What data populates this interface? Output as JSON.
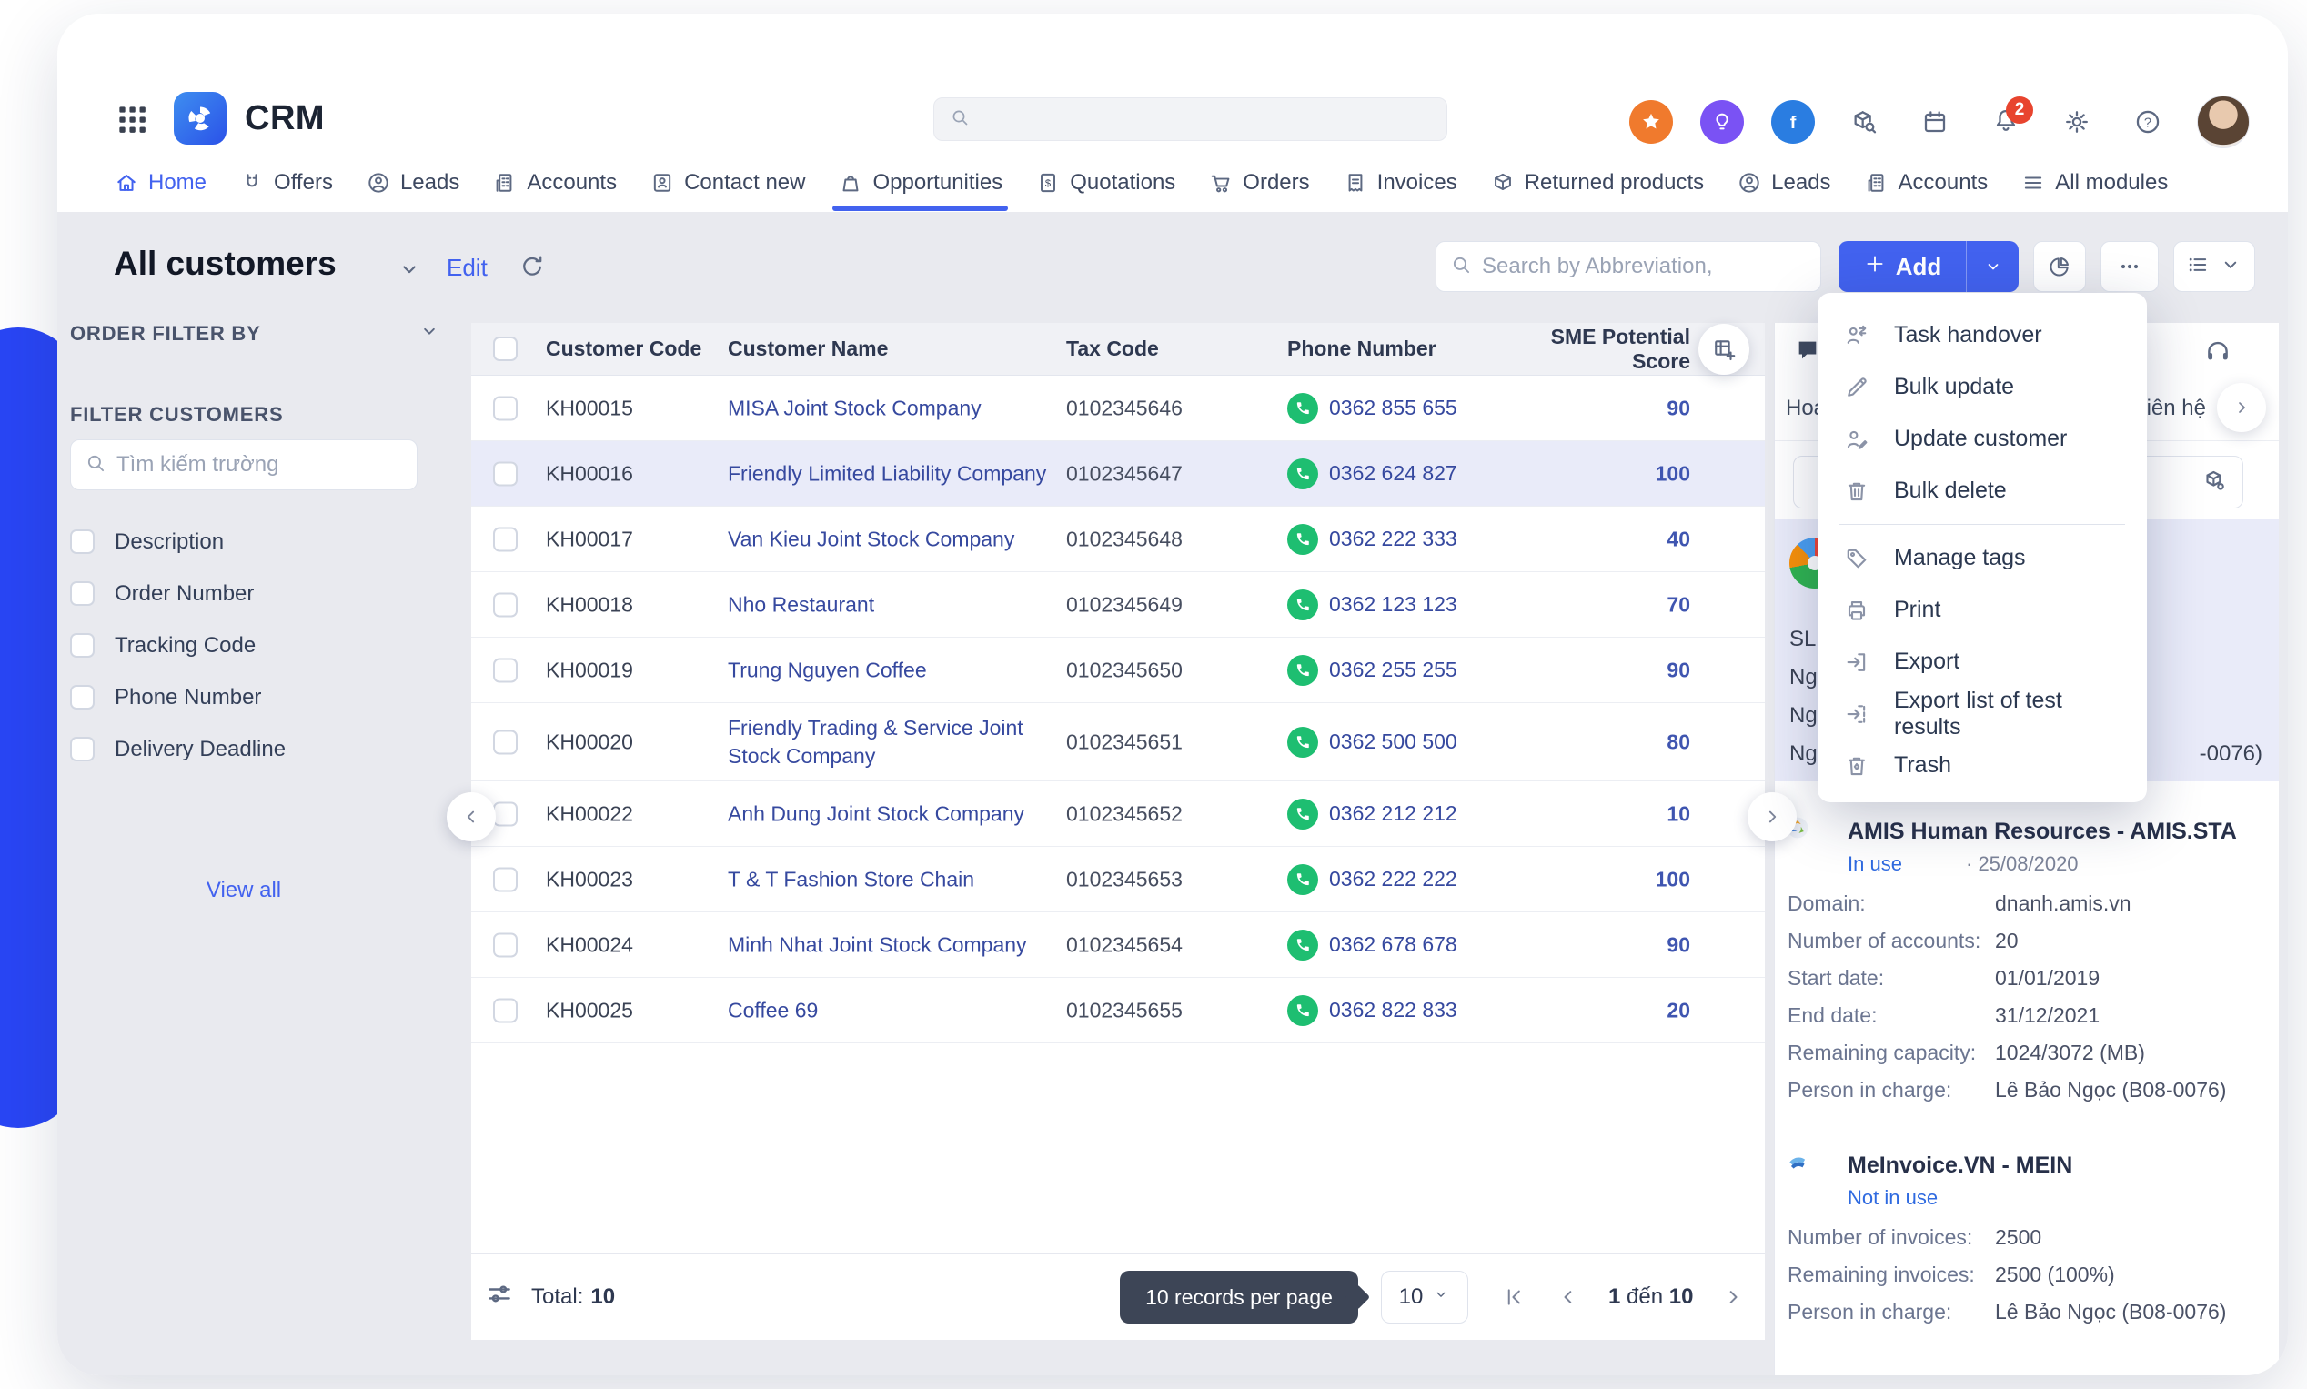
{
  "colors": {
    "accent": "#4262ef",
    "link": "#36499f",
    "green": "#1ebe71",
    "highlight": "#e9ebf9",
    "tooltip_bg": "#3d4556",
    "blob": "#2946f5"
  },
  "topbar": {
    "app_name": "CRM",
    "global_search_placeholder": "",
    "notification_count": "2"
  },
  "nav": {
    "active_index": 5,
    "items": [
      {
        "label": "Home",
        "icon": "home"
      },
      {
        "label": "Offers",
        "icon": "magnet"
      },
      {
        "label": "Leads",
        "icon": "person-circle"
      },
      {
        "label": "Accounts",
        "icon": "building"
      },
      {
        "label": "Contact new",
        "icon": "contact-card"
      },
      {
        "label": "Opportunities",
        "icon": "wallet"
      },
      {
        "label": "Quotations",
        "icon": "doc-dollar"
      },
      {
        "label": "Orders",
        "icon": "cart"
      },
      {
        "label": "Invoices",
        "icon": "receipt"
      },
      {
        "label": "Returned products",
        "icon": "box"
      },
      {
        "label": "Leads",
        "icon": "person-circle"
      },
      {
        "label": "Accounts",
        "icon": "building"
      },
      {
        "label": "All modules",
        "icon": "menu-lines"
      }
    ]
  },
  "page_header": {
    "title": "All customers",
    "edit_label": "Edit",
    "search_placeholder": "Search by Abbreviation,",
    "add_label": "Add"
  },
  "sidebar": {
    "section_order": "ORDER FILTER BY",
    "section_filter": "FILTER CUSTOMERS",
    "search_placeholder": "Tìm kiếm trường",
    "filters": [
      "Description",
      "Order Number",
      "Tracking Code",
      "Phone Number",
      "Delivery Deadline"
    ],
    "view_all": "View all"
  },
  "table": {
    "columns": [
      "Customer Code",
      "Customer Name",
      "Tax Code",
      "Phone Number",
      "SME Potential Score"
    ],
    "rows": [
      {
        "code": "KH00015",
        "name": "MISA Joint Stock Company",
        "tax": "0102345646",
        "phone": "0362 855 655",
        "score": "90",
        "highlight": false
      },
      {
        "code": "KH00016",
        "name": "Friendly Limited Liability Company",
        "tax": "0102345647",
        "phone": "0362 624 827",
        "score": "100",
        "highlight": true
      },
      {
        "code": "KH00017",
        "name": "Van Kieu Joint Stock Company",
        "tax": "0102345648",
        "phone": "0362 222 333",
        "score": "40",
        "highlight": false
      },
      {
        "code": "KH00018",
        "name": "Nho Restaurant",
        "tax": "0102345649",
        "phone": "0362 123 123",
        "score": "70",
        "highlight": false
      },
      {
        "code": "KH00019",
        "name": "Trung Nguyen Coffee",
        "tax": "0102345650",
        "phone": "0362 255 255",
        "score": "90",
        "highlight": false
      },
      {
        "code": "KH00020",
        "name": "Friendly Trading & Service Joint Stock Company",
        "tax": "0102345651",
        "phone": "0362 500 500",
        "score": "80",
        "highlight": false,
        "tall": true
      },
      {
        "code": "KH00022",
        "name": "Anh Dung Joint Stock Company",
        "tax": "0102345652",
        "phone": "0362 212 212",
        "score": "10",
        "highlight": false
      },
      {
        "code": "KH00023",
        "name": "T & T Fashion Store Chain",
        "tax": "0102345653",
        "phone": "0362 222 222",
        "score": "100",
        "highlight": false
      },
      {
        "code": "KH00024",
        "name": "Minh Nhat Joint Stock Company",
        "tax": "0102345654",
        "phone": "0362 678 678",
        "score": "90",
        "highlight": false
      },
      {
        "code": "KH00025",
        "name": "Coffee 69",
        "tax": "0102345655",
        "phone": "0362 822 833",
        "score": "20",
        "highlight": false
      }
    ]
  },
  "menu": {
    "group1": [
      {
        "label": "Task handover",
        "icon": "users-arrows"
      },
      {
        "label": "Bulk update",
        "icon": "pencil"
      },
      {
        "label": "Update customer",
        "icon": "user-edit"
      },
      {
        "label": "Bulk delete",
        "icon": "trash"
      }
    ],
    "group2": [
      {
        "label": "Manage tags",
        "icon": "tag"
      },
      {
        "label": "Print",
        "icon": "printer"
      },
      {
        "label": "Export",
        "icon": "export"
      },
      {
        "label": "Export list of test results",
        "icon": "export-check"
      },
      {
        "label": "Trash",
        "icon": "trash-alt"
      }
    ]
  },
  "right_panel": {
    "activity_tab_fragment": "Hoa",
    "contact_tab": "Liên hệ",
    "selected_fragments": [
      "SL",
      "Ng",
      "Ng",
      "Ng"
    ],
    "selected_fragment_right": "-0076)",
    "apps": [
      {
        "name": "AMIS Human Resources - AMIS.STA",
        "status": "In use",
        "date": "·  25/08/2020",
        "rows": [
          {
            "label": "Domain:",
            "value": "dnanh.amis.vn"
          },
          {
            "label": "Number of accounts:",
            "value": "20"
          },
          {
            "label": "Start date:",
            "value": "01/01/2019"
          },
          {
            "label": "End date:",
            "value": "31/12/2021"
          },
          {
            "label": "Remaining capacity:",
            "value": "1024/3072 (MB)"
          },
          {
            "label": "Person in charge:",
            "value": "Lê Bảo Ngọc (B08-0076)"
          }
        ]
      },
      {
        "name": "MeInvoice.VN - MEIN",
        "status": "Not in use",
        "date": "",
        "rows": [
          {
            "label": "Number of invoices:",
            "value": "2500"
          },
          {
            "label": "Remaining invoices:",
            "value": "2500 (100%)"
          },
          {
            "label": "Person in charge:",
            "value": "Lê Bảo Ngọc (B08-0076)"
          }
        ]
      }
    ]
  },
  "footer": {
    "total_label": "Total:",
    "total_value": "10",
    "tooltip": "10 records per page",
    "page_size": "10",
    "range_start": "1",
    "range_sep": "đến",
    "range_end": "10"
  }
}
